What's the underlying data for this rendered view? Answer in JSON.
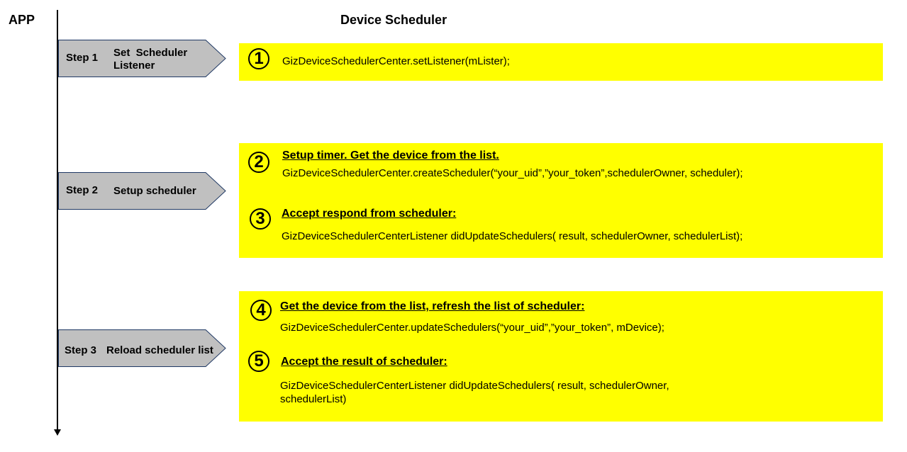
{
  "header": {
    "app_label": "APP",
    "title": "Device Scheduler"
  },
  "steps": [
    {
      "num": "Step 1",
      "label": "Set  Scheduler\nListener"
    },
    {
      "num": "Step 2",
      "label": "Setup scheduler"
    },
    {
      "num": "Step 3",
      "label": "Reload scheduler list"
    }
  ],
  "actions": [
    {
      "num": "1",
      "heading": "",
      "code": "GizDeviceSchedulerCenter.setListener(mLister);"
    },
    {
      "num": "2",
      "heading": "Setup timer. Get the device from the list.",
      "code": "GizDeviceSchedulerCenter.createScheduler(“your_uid”,”your_token”,schedulerOwner, scheduler);"
    },
    {
      "num": "3",
      "heading": "Accept respond from scheduler:",
      "code": "GizDeviceSchedulerCenterListener didUpdateSchedulers( result, schedulerOwner, schedulerList);"
    },
    {
      "num": "4",
      "heading": "Get the device from the list, refresh the list of scheduler:",
      "code": "GizDeviceSchedulerCenter.updateSchedulers(“your_uid”,”your_token”, mDevice);"
    },
    {
      "num": "5",
      "heading": "Accept the result of scheduler:",
      "code_line1": "GizDeviceSchedulerCenterListener didUpdateSchedulers( result, schedulerOwner,",
      "code_line2": "schedulerList)"
    }
  ],
  "colors": {
    "highlight_box": "#ffff00",
    "step_arrow_fill": "#c0c0c0",
    "step_arrow_stroke": "#1f3864"
  }
}
